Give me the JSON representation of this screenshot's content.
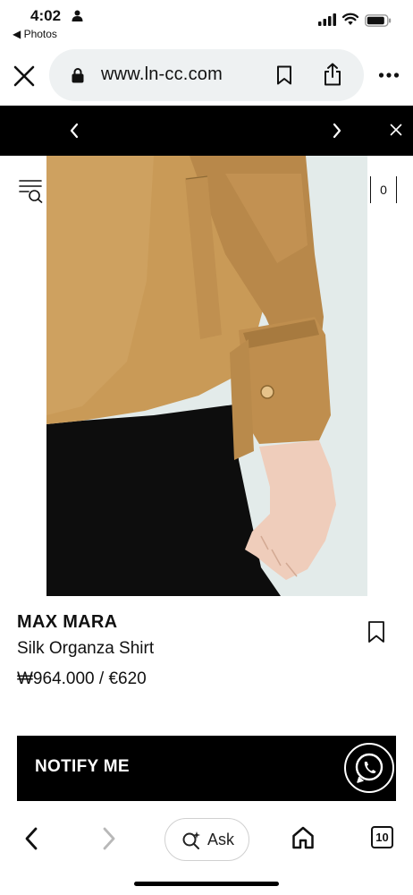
{
  "status_bar": {
    "time": "4:02",
    "back_app": "◀ Photos"
  },
  "browser": {
    "url": "www.ln-cc.com",
    "close_icon": "close-icon",
    "lock_icon": "lock-icon",
    "bookmark_icon": "bookmark-icon",
    "share_icon": "share-icon",
    "more_icon": "more-icon"
  },
  "announcement": {
    "prev_icon": "chevron-left-icon",
    "next_icon": "chevron-right-icon",
    "close_icon": "close-icon"
  },
  "site_header": {
    "menu_icon": "menu-search-icon",
    "cart_count": "0"
  },
  "product": {
    "brand": "MAX MARA",
    "name": "Silk Organza Shirt",
    "price": "₩964.000 / €620",
    "wishlist_icon": "bookmark-icon"
  },
  "actions": {
    "notify_label": "NOTIFY ME",
    "chat_icon": "whatsapp-icon"
  },
  "toolbar": {
    "ask_label": "Ask",
    "tab_count": "10"
  },
  "colors": {
    "accent": "#000000",
    "url_bar_bg": "#eef1f2",
    "shirt": "#c99a57",
    "backdrop": "#e4eceb"
  }
}
